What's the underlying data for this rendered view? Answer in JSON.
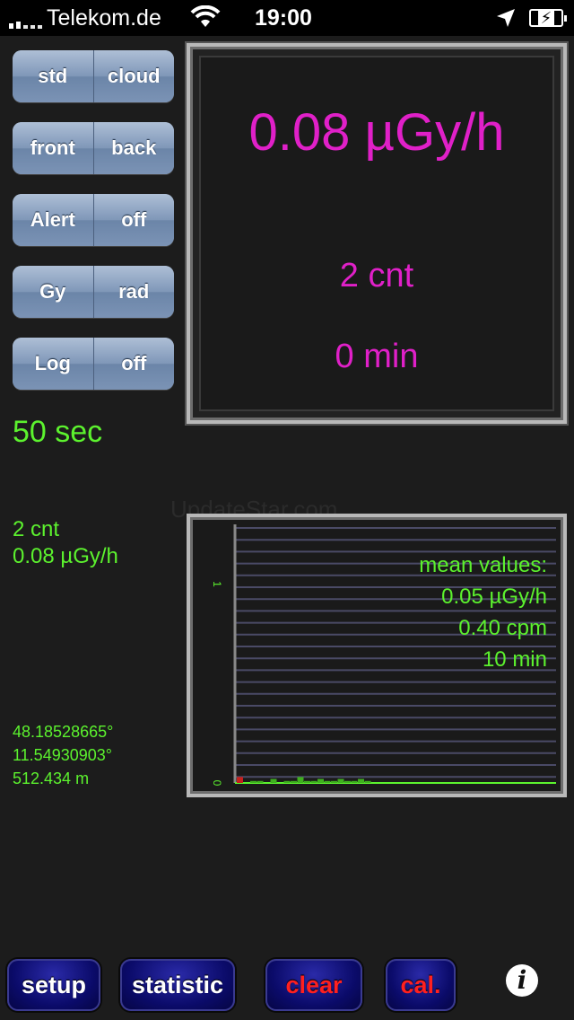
{
  "status_bar": {
    "carrier": "Telekom.de",
    "time": "19:00"
  },
  "toggles": [
    {
      "left": "std",
      "right": "cloud"
    },
    {
      "left": "front",
      "right": "back"
    },
    {
      "left": "Alert",
      "right": "off"
    },
    {
      "left": "Gy",
      "right": "rad"
    },
    {
      "left": "Log",
      "right": "off"
    }
  ],
  "readout": {
    "dose_rate": "0.08 µGy/h",
    "counts": "2 cnt",
    "duration": "0 min"
  },
  "left_info": {
    "timer": "50 sec",
    "counts": "2 cnt",
    "dose_rate": "0.08 µGy/h",
    "latitude": "48.18528665°",
    "longitude": "11.54930903°",
    "altitude": "512.434 m"
  },
  "watermark": "UpdateStar.com",
  "chart_data": {
    "type": "bar",
    "y_ticks": [
      "0",
      "1"
    ],
    "ylim": [
      0,
      1.3
    ],
    "values": [
      0.03,
      0,
      0.01,
      0.01,
      0,
      0.02,
      0,
      0.01,
      0.01,
      0.03,
      0.01,
      0.01,
      0.02,
      0.01,
      0.01,
      0.02,
      0.01,
      0.01,
      0.02,
      0.01,
      0,
      0,
      0,
      0,
      0,
      0,
      0,
      0,
      0,
      0
    ],
    "colors": {
      "bar": "#3fb01f",
      "first_bar": "#c8201c",
      "baseline": "#5cf22e",
      "grid": "#4a4a66",
      "axis": "#888888"
    },
    "mean_title": "mean values:",
    "mean_dose": "0.05 µGy/h",
    "mean_cpm": "0.40 cpm",
    "mean_duration": "10 min"
  },
  "buttons": {
    "setup": "setup",
    "statistic": "statistic",
    "clear": "clear",
    "cal": "cal.",
    "info": "i"
  }
}
